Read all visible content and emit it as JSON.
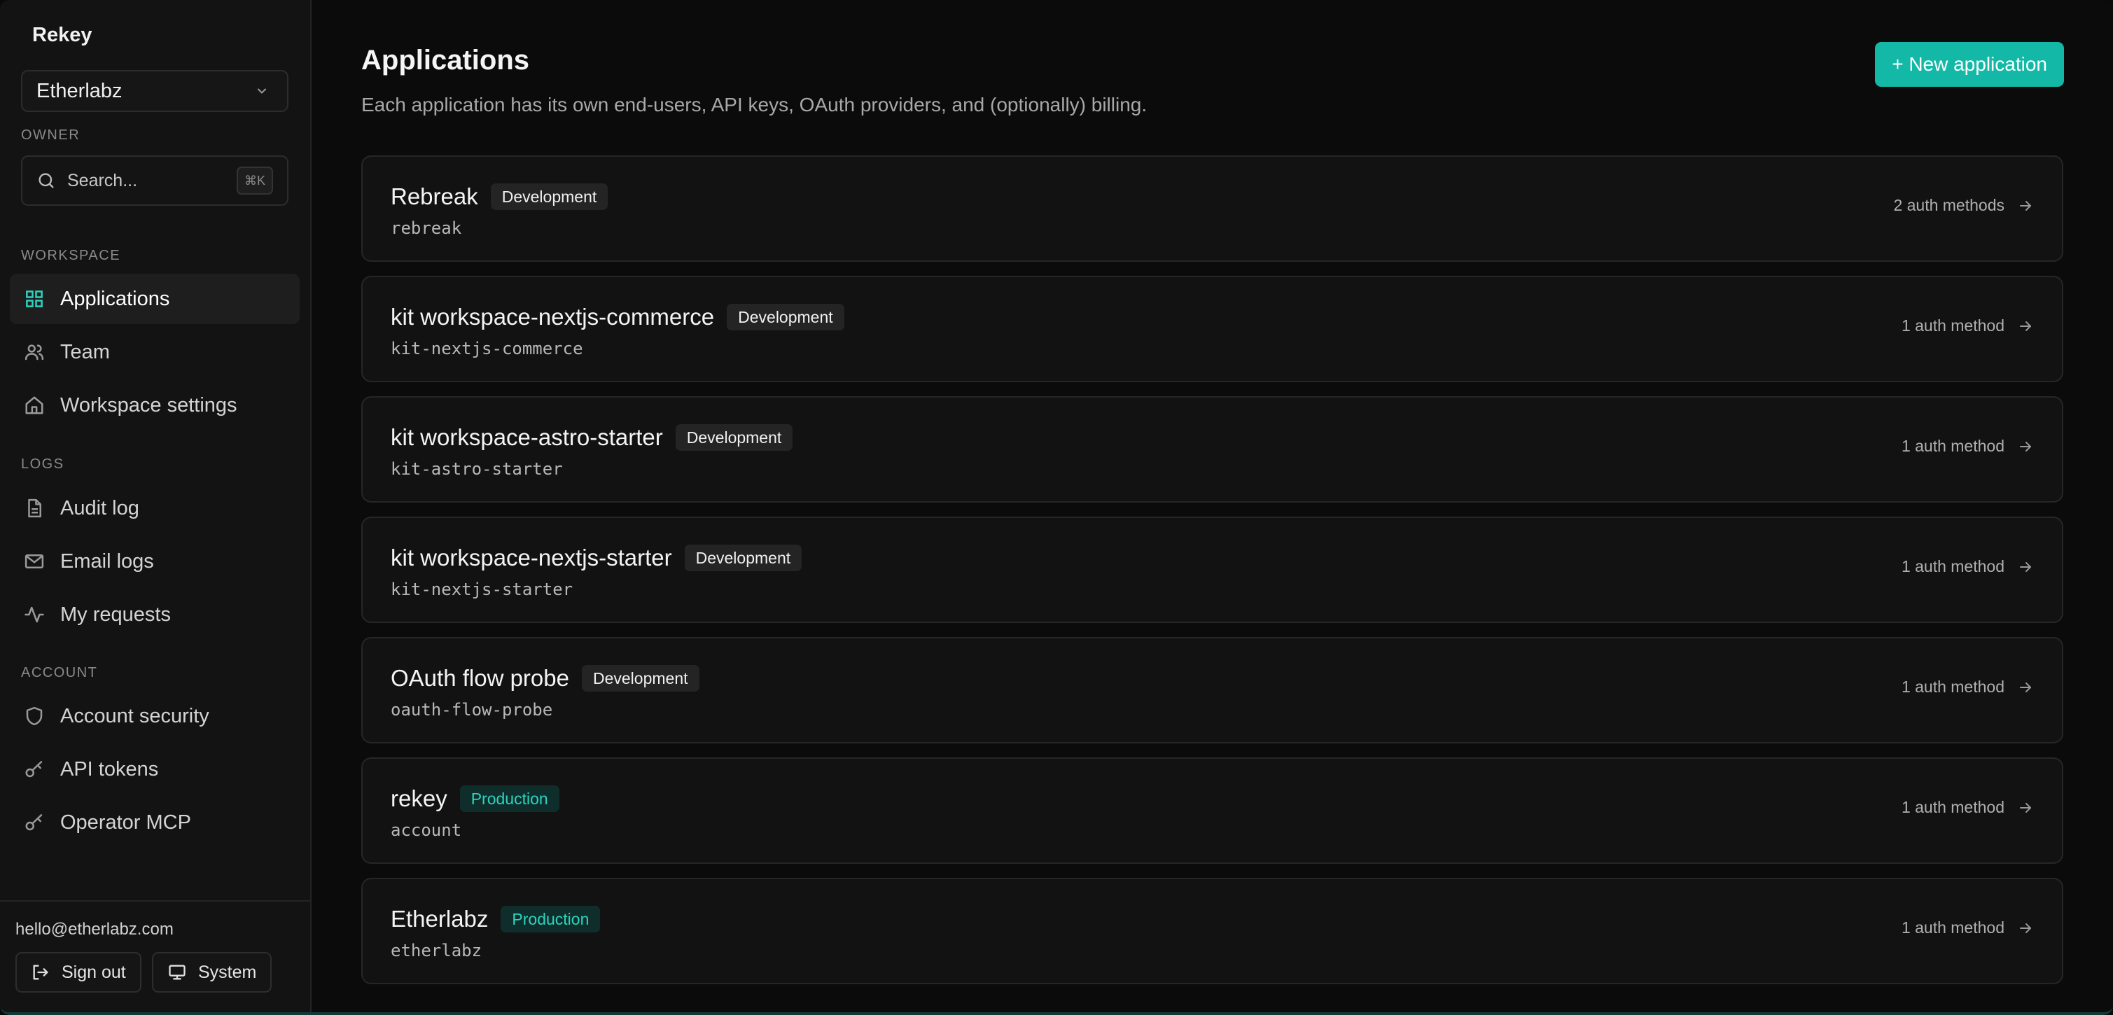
{
  "sidebar": {
    "brand": "Rekey",
    "org": "Etherlabz",
    "owner_label": "OWNER",
    "search": {
      "placeholder": "Search...",
      "shortcut": "⌘K"
    },
    "workspace_label": "WORKSPACE",
    "workspace_items": [
      {
        "label": "Applications",
        "icon": "grid-icon",
        "active": true
      },
      {
        "label": "Team",
        "icon": "users-icon"
      },
      {
        "label": "Workspace settings",
        "icon": "home-icon"
      }
    ],
    "logs_label": "LOGS",
    "logs_items": [
      {
        "label": "Audit log",
        "icon": "file-icon"
      },
      {
        "label": "Email logs",
        "icon": "mail-icon"
      },
      {
        "label": "My requests",
        "icon": "activity-icon"
      }
    ],
    "account_label": "ACCOUNT",
    "account_items": [
      {
        "label": "Account security",
        "icon": "shield-icon"
      },
      {
        "label": "API tokens",
        "icon": "key-icon"
      },
      {
        "label": "Operator MCP",
        "icon": "key-icon"
      }
    ],
    "footer": {
      "email": "hello@etherlabz.com",
      "sign_out": "Sign out",
      "theme": "System"
    }
  },
  "main": {
    "title": "Applications",
    "subtitle": "Each application has its own end-users, API keys, OAuth providers, and (optionally) billing.",
    "new_button": "+ New application",
    "apps": [
      {
        "name": "Rebreak",
        "env": "Development",
        "slug": "rebreak",
        "auth": "2 auth methods"
      },
      {
        "name": "kit workspace-nextjs-commerce",
        "env": "Development",
        "slug": "kit-nextjs-commerce",
        "auth": "1 auth method"
      },
      {
        "name": "kit workspace-astro-starter",
        "env": "Development",
        "slug": "kit-astro-starter",
        "auth": "1 auth method"
      },
      {
        "name": "kit workspace-nextjs-starter",
        "env": "Development",
        "slug": "kit-nextjs-starter",
        "auth": "1 auth method"
      },
      {
        "name": "OAuth flow probe",
        "env": "Development",
        "slug": "oauth-flow-probe",
        "auth": "1 auth method"
      },
      {
        "name": "rekey",
        "env": "Production",
        "slug": "account",
        "auth": "1 auth method"
      },
      {
        "name": "Etherlabz",
        "env": "Production",
        "slug": "etherlabz",
        "auth": "1 auth method"
      }
    ]
  },
  "colors": {
    "accent": "#14b8a6",
    "prod_badge_text": "#2dd4bf"
  }
}
